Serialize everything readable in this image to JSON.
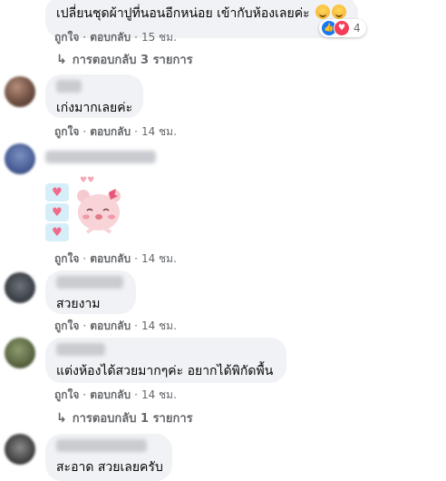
{
  "comments": [
    {
      "text": "เปลี่ยนชุดผ้าปูที่นอนอีกหน่อย เข้ากับห้องเลยค่ะ",
      "like": "ถูกใจ",
      "reply": "ตอบกลับ",
      "time": "15 ชม.",
      "reaction_count": "4",
      "replies_label": "การตอบกลับ 3 รายการ"
    },
    {
      "text": "เก่งมากเลยค่ะ",
      "like": "ถูกใจ",
      "reply": "ตอบกลับ",
      "time": "14 ชม."
    },
    {
      "sticker": "heart-bear-sticker",
      "like": "ถูกใจ",
      "reply": "ตอบกลับ",
      "time": "14 ชม."
    },
    {
      "text": "สวยงาม",
      "like": "ถูกใจ",
      "reply": "ตอบกลับ",
      "time": "14 ชม."
    },
    {
      "text": "แต่งห้องได้สวยมากๆค่ะ อยากได้พิกัดพื้น",
      "like": "ถูกใจ",
      "reply": "ตอบกลับ",
      "time": "14 ชม.",
      "replies_label": "การตอบกลับ 1 รายการ"
    },
    {
      "text": "สะอาด สวยเลยครับ"
    }
  ],
  "colors": {
    "bubble": "#f0f2f5",
    "meta_text": "#65676b",
    "like_blue": "#1877f2",
    "love_red": "#f33e58"
  }
}
